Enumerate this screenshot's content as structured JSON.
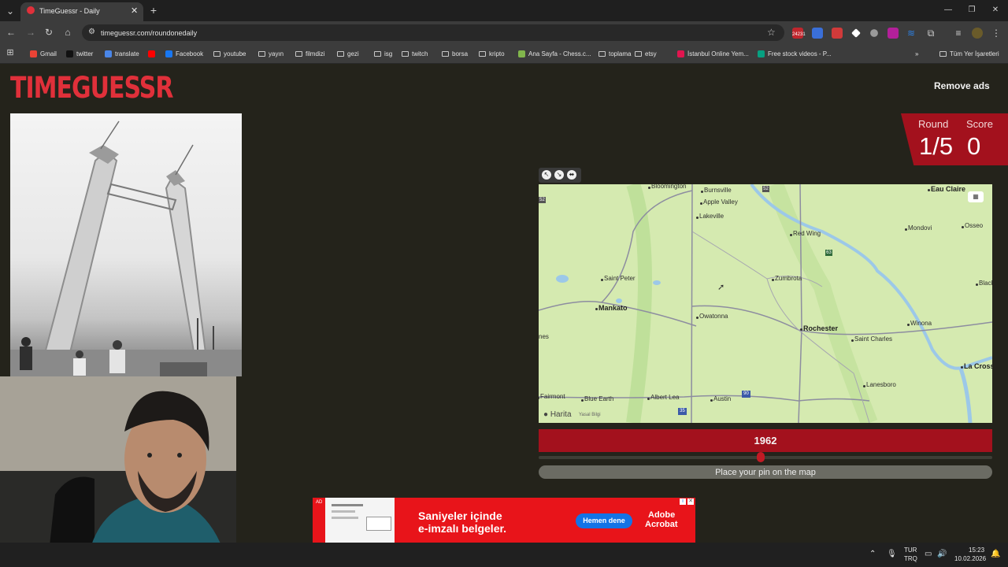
{
  "browser": {
    "tab_title": "TimeGuessr - Daily",
    "new_tab": "+",
    "url": "timeguessr.com/roundonedaily",
    "extension_badge": "24231",
    "window_controls": [
      "—",
      "❐",
      "✕"
    ]
  },
  "bookmarks": [
    {
      "label": "Gmail",
      "icon": "gmail-icon"
    },
    {
      "label": "twitter",
      "icon": "x-icon"
    },
    {
      "label": "translate",
      "icon": "translate-icon"
    },
    {
      "label": "",
      "icon": "youtube-icon"
    },
    {
      "label": "Facebook",
      "icon": "facebook-icon"
    },
    {
      "label": "youtube",
      "icon": "folder-icon"
    },
    {
      "label": "yayın",
      "icon": "folder-icon"
    },
    {
      "label": "filmdizi",
      "icon": "folder-icon"
    },
    {
      "label": "gezi",
      "icon": "folder-icon"
    },
    {
      "label": "isg",
      "icon": "folder-icon"
    },
    {
      "label": "twitch",
      "icon": "folder-icon"
    },
    {
      "label": "borsa",
      "icon": "folder-icon"
    },
    {
      "label": "kripto",
      "icon": "folder-icon"
    },
    {
      "label": "Ana Sayfa - Chess.c...",
      "icon": "chess-icon"
    },
    {
      "label": "toplama",
      "icon": "folder-icon"
    },
    {
      "label": "etsy",
      "icon": "folder-icon"
    },
    {
      "label": "İstanbul Online Yem...",
      "icon": "yemeksepeti-icon"
    },
    {
      "label": "Free stock videos - P...",
      "icon": "pexels-icon"
    }
  ],
  "all_bookmarks": "Tüm Yer İşaretleri",
  "page": {
    "logo": "TIMEGUESSR",
    "remove_ads": "Remove ads",
    "round_label": "Round",
    "score_label": "Score",
    "round_value": "1/5",
    "score_value": "0",
    "year": "1962",
    "pin_hint": "Place your pin on the map"
  },
  "map": {
    "attribution_brand": "Harita",
    "attribution_legal": "Yasal Bilgi",
    "cities": [
      {
        "name": "Bloomington",
        "big": false
      },
      {
        "name": "Burnsville",
        "big": false
      },
      {
        "name": "Apple Valley",
        "big": false
      },
      {
        "name": "Lakeville",
        "big": false
      },
      {
        "name": "Eau Claire",
        "big": true
      },
      {
        "name": "Red Wing",
        "big": false
      },
      {
        "name": "Mondovi",
        "big": false
      },
      {
        "name": "Osseo",
        "big": false
      },
      {
        "name": "Saint Peter",
        "big": false
      },
      {
        "name": "Zumbrota",
        "big": false
      },
      {
        "name": "Black Ri",
        "big": false
      },
      {
        "name": "Mankato",
        "big": true
      },
      {
        "name": "Owatonna",
        "big": false
      },
      {
        "name": "Rochester",
        "big": true
      },
      {
        "name": "Winona",
        "big": false
      },
      {
        "name": "Saint Charles",
        "big": false
      },
      {
        "name": "La Cross",
        "big": true
      },
      {
        "name": "nes",
        "big": false
      },
      {
        "name": "Fairmont",
        "big": false
      },
      {
        "name": "Blue Earth",
        "big": false
      },
      {
        "name": "Albert Lea",
        "big": false
      },
      {
        "name": "Austin",
        "big": false
      },
      {
        "name": "Lanesboro",
        "big": false
      }
    ],
    "shields": [
      "52",
      "63",
      "52",
      "90",
      "35"
    ]
  },
  "ad": {
    "label": "AD",
    "headline_line1": "Saniyeler içinde",
    "headline_line2": "e-imzalı belgeler.",
    "cta": "Hemen dene",
    "brand_line1": "Adobe",
    "brand_line2": "Acrobat"
  },
  "taskbar": {
    "lang_line1": "TUR",
    "lang_line2": "TRQ",
    "time": "15:23",
    "date": "10.02.2026"
  }
}
